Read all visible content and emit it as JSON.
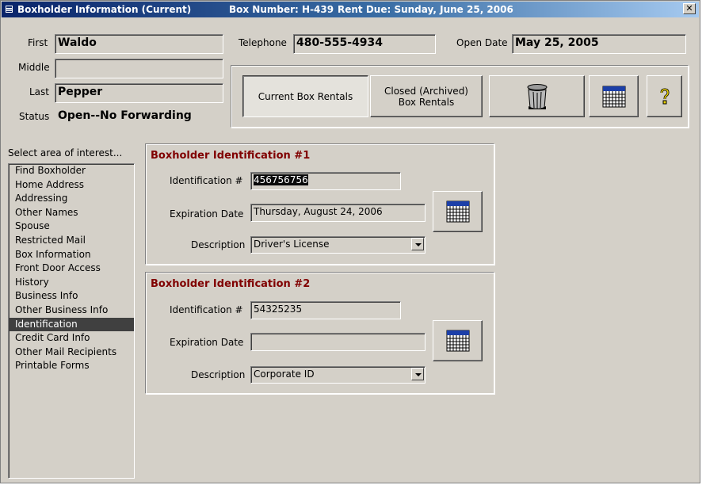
{
  "titlebar": {
    "title": "Boxholder Information (Current)",
    "box_number": "Box Number: H-439",
    "rent_due": "Rent Due: Sunday, June 25, 2006",
    "close_glyph": "✕"
  },
  "name": {
    "first_label": "First",
    "first_value": "Waldo",
    "middle_label": "Middle",
    "middle_value": "",
    "last_label": "Last",
    "last_value": "Pepper",
    "status_label": "Status",
    "status_value": "Open--No Forwarding"
  },
  "contact": {
    "telephone_label": "Telephone",
    "telephone_value": "480-555-4934",
    "open_date_label": "Open Date",
    "open_date_value": "May 25, 2005"
  },
  "buttons": {
    "current_rentals": "Current Box Rentals",
    "closed_rentals_line1": "Closed (Archived)",
    "closed_rentals_line2": "Box Rentals",
    "delete_icon": "trash-can-icon",
    "calendar_icon": "calendar-icon",
    "help_icon": "question-mark-icon"
  },
  "nav": {
    "heading": "Select area of interest...",
    "items": [
      "Find Boxholder",
      "Home Address",
      "Addressing",
      "Other Names",
      "Spouse",
      "Restricted Mail",
      "Box Information",
      "Front Door Access",
      "History",
      "Business Info",
      "Other Business Info",
      "Identification",
      "Credit Card Info",
      "Other Mail Recipients",
      "Printable Forms"
    ],
    "selected": "Identification"
  },
  "id1": {
    "title": "Boxholder Identification #1",
    "id_label": "Identification #",
    "id_value_first": "4",
    "id_value_rest": "56756756",
    "exp_label": "Expiration Date",
    "exp_value": "Thursday, August 24, 2006",
    "desc_label": "Description",
    "desc_value": "Driver's License"
  },
  "id2": {
    "title": "Boxholder Identification #2",
    "id_label": "Identification #",
    "id_value": "54325235",
    "exp_label": "Expiration Date",
    "exp_value": "",
    "desc_label": "Description",
    "desc_value": "Corporate ID"
  },
  "colors": {
    "title_gradient_start": "#0a246a",
    "section_title": "#800000",
    "face": "#d4d0c8",
    "selection": "#404040"
  }
}
